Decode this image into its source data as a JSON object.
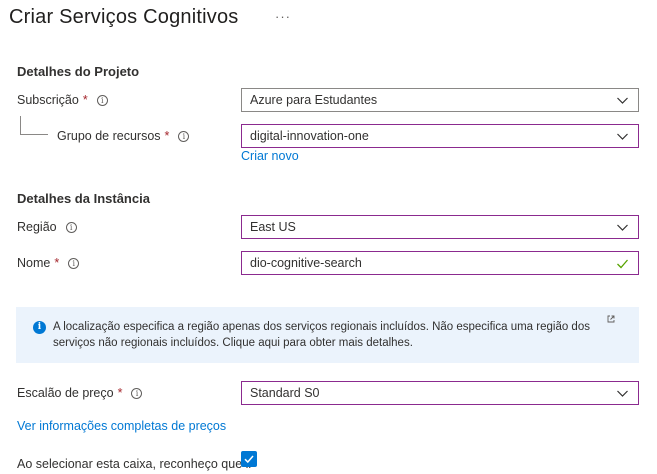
{
  "header": {
    "title": "Criar Serviços Cognitivos",
    "more_icon": "more-ellipsis-icon",
    "more_label": "···"
  },
  "project": {
    "section_title": "Detalhes do Projeto",
    "subscription": {
      "label": "Subscrição",
      "required_mark": "*",
      "value": "Azure para Estudantes"
    },
    "resource_group": {
      "label": "Grupo de recursos",
      "required_mark": "*",
      "value": "digital-innovation-one",
      "create_link": "Criar novo"
    }
  },
  "instance": {
    "section_title": "Detalhes da Instância",
    "region": {
      "label": "Região",
      "value": "East US"
    },
    "name": {
      "label": "Nome",
      "required_mark": "*",
      "value": "dio-cognitive-search"
    }
  },
  "info_box": {
    "text": "A localização especifica a região apenas dos serviços regionais incluídos. Não especifica uma região dos serviços não regionais incluídos. Clique aqui para obter mais detalhes.",
    "icon": "info-circle-icon",
    "link_icon": "external-link-icon"
  },
  "pricing": {
    "label": "Escalão de preço",
    "required_mark": "*",
    "value": "Standard S0",
    "details_link": "Ver informações completas de preços"
  },
  "acknowledge": {
    "text": "Ao selecionar esta caixa, reconheço que li",
    "checked": true
  },
  "colors": {
    "accent": "#0078d4",
    "required": "#a4262c",
    "focus_border": "#8b2a8f",
    "valid": "#57a300",
    "info_bg": "#ebf3fc"
  }
}
